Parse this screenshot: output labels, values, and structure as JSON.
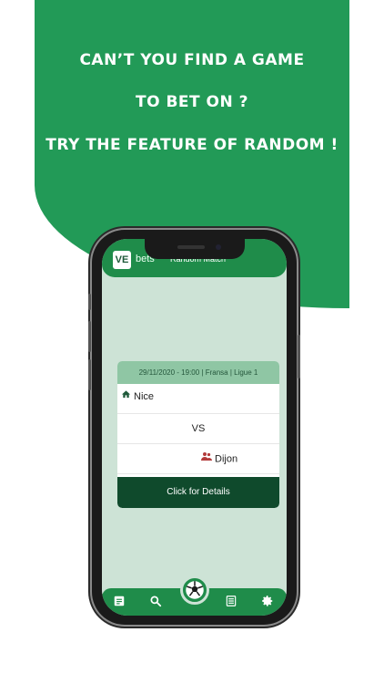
{
  "promo": {
    "line1": "CAN’T YOU FIND A GAME",
    "line2": "TO BET ON ?",
    "line3": "TRY THE FEATURE OF RANDOM !"
  },
  "app": {
    "logo_mark": "VE",
    "logo_text": "bets",
    "screen_title": "Random Match"
  },
  "match": {
    "info": "29/11/2020 - 19:00 | Fransa | Ligue 1",
    "home_team": "Nice",
    "vs": "VS",
    "away_team": "Dijon",
    "details_label": "Click for Details"
  },
  "nav": {
    "items": [
      {
        "icon": "document-icon"
      },
      {
        "icon": "search-icon"
      },
      {
        "icon": "soccer-ball-icon"
      },
      {
        "icon": "list-icon"
      },
      {
        "icon": "gear-icon"
      }
    ]
  },
  "colors": {
    "brand_green": "#229a57",
    "app_bar": "#1f8c4a",
    "card_header": "#8fc6a4",
    "details_button": "#0f4a2c",
    "screen_bg": "#cde3d6",
    "away_icon": "#b23a3a"
  }
}
